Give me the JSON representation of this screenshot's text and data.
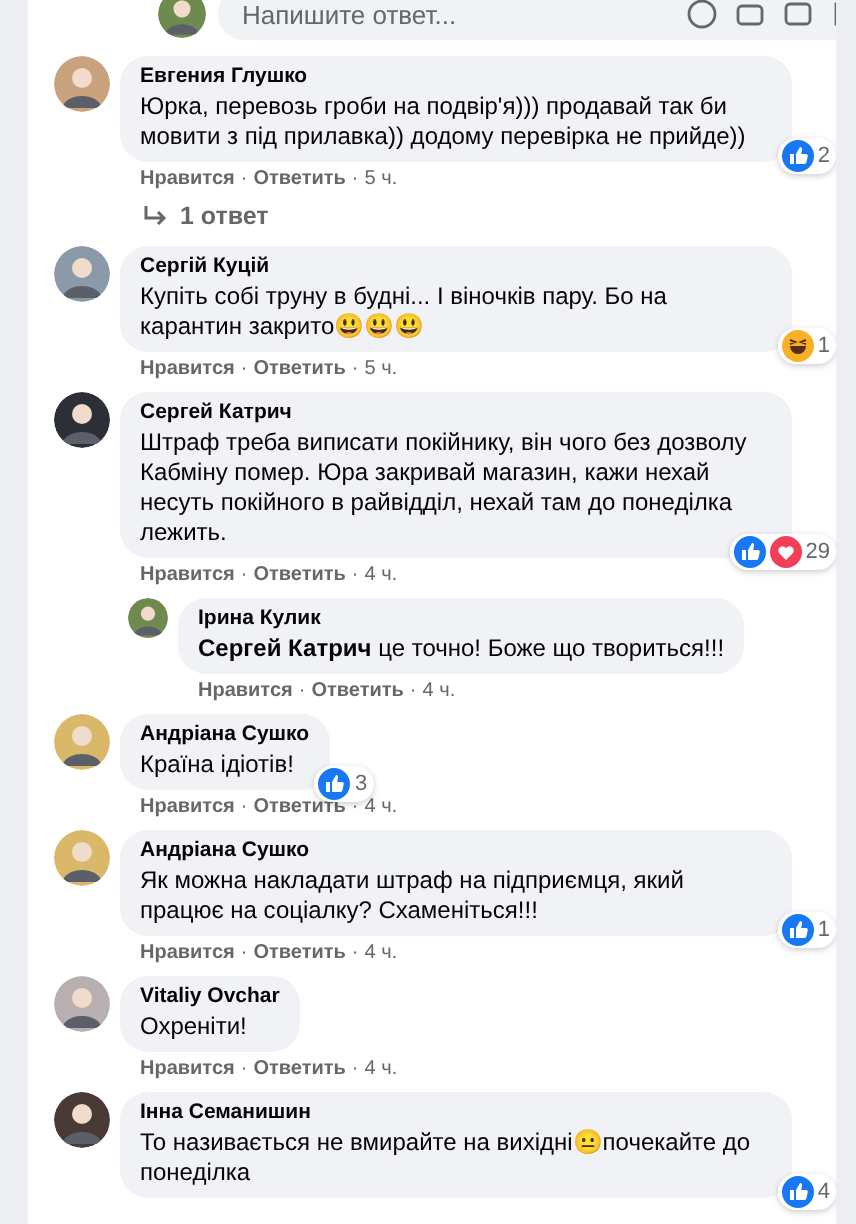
{
  "reply_box": {
    "placeholder": "Напишите ответ..."
  },
  "meta_separator": "·",
  "comments": [
    {
      "author": "Евгения Глушко",
      "text": "Юрка, перевозь гроби на подвір'я))) продавай так би мовити з під прилавка)) додому перевірка не прийде))",
      "reactions": {
        "kind": "like",
        "count": "2"
      },
      "actions": [
        "Нравится",
        "Ответить",
        "5 ч."
      ],
      "replies_link": "1 ответ"
    },
    {
      "author": "Сергій Куцій",
      "text": "Купіть собі труну в будні... І віночків пару. Бо на карантин закрито😃😃😃",
      "reactions": {
        "kind": "haha",
        "count": "1"
      },
      "actions": [
        "Нравится",
        "Ответить",
        "5 ч."
      ]
    },
    {
      "author": "Сергей Катрич",
      "text": "Штраф треба виписати покійнику, він чого без дозволу Кабміну помер. Юра закривай магазин, кажи нехай несуть покійного в райвідділ, нехай там до понеділка лежить.",
      "reactions": {
        "kind": "like_love",
        "count": "29"
      },
      "actions": [
        "Нравится",
        "Ответить",
        "4 ч."
      ],
      "replies": [
        {
          "author": "Ірина Кулик",
          "text": "**Сергей Катрич** це точно! Боже що твориться!!!",
          "actions": [
            "Нравится",
            "Ответить",
            "4 ч."
          ]
        }
      ]
    },
    {
      "author": "Андріана Сушко",
      "text": "Країна ідіотів!",
      "reactions": {
        "kind": "like",
        "count": "3"
      },
      "actions": [
        "Нравится",
        "Ответить",
        "4 ч."
      ]
    },
    {
      "author": "Андріана Сушко",
      "text": "Як можна накладати штраф на підприємця, який працює на соціалку? Схаменіться!!!",
      "reactions": {
        "kind": "like",
        "count": "1"
      },
      "actions": [
        "Нравится",
        "Ответить",
        "4 ч."
      ]
    },
    {
      "author": "Vitaliy Ovchar",
      "text": "Охреніти!",
      "actions": [
        "Нравится",
        "Ответить",
        "4 ч."
      ]
    },
    {
      "author": "Інна Семанишин",
      "text": "То називається не вмирайте на вихідні😐почекайте до понеділка",
      "reactions": {
        "kind": "like",
        "count": "4"
      }
    }
  ]
}
